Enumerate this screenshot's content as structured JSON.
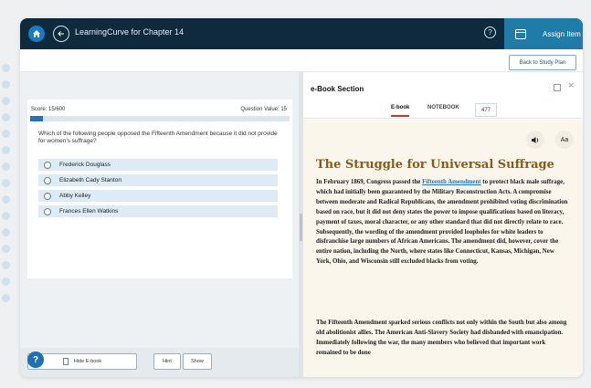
{
  "app": {
    "title": "LearningCurve for Chapter 14",
    "assign_label": "Assign Item",
    "back_to_study_plan": "Back to Study Plan",
    "colors": {
      "topbar": "#0f2a3d",
      "accent": "#1f7ba8",
      "heading": "#8a5a10",
      "link": "#2a6fb8"
    }
  },
  "quiz": {
    "score": "Score: 15/600",
    "question_value": "Question Value: 15",
    "progress_fraction": 0.05,
    "question": "Which of the following people opposed the Fifteenth Amendment because it did not provide for women's suffrage?",
    "options": [
      "Frederick Douglass",
      "Elizabeth Cady Stanton",
      "Abby Kelley",
      "Frances Ellen Watkins"
    ],
    "hide_ebook": "Hide E-book",
    "hint": "Hint",
    "show": "Show"
  },
  "ebook": {
    "section_title": "e-Book Section",
    "tabs": [
      "E-book",
      "NOTEBOOK"
    ],
    "tab_count": "477",
    "aa_label": "Aa",
    "heading": "The Struggle for Universal Suffrage",
    "p1_before": "In February 1869, Congress passed the ",
    "p1_link": "Fifteenth Amendment",
    "p1_after": " to protect black male suffrage, which had initially been guaranteed by the Military Reconstruction Acts. A compromise between moderate and Radical Republicans, the amendment prohibited voting discrimination based on race, but it did not deny states the power to impose qualifications based on literacy, payment of taxes, moral character, or any other standard that did not directly relate to race. Subsequently, the wording of the amendment provided loopholes for white leaders to disfranchise large numbers of African Americans. The amendment did, however, cover the entire nation, including the North, where states like Connecticut, Kansas, Michigan, New York, Ohio, and Wisconsin still excluded blacks from voting.",
    "p2": "The Fifteenth Amendment sparked serious conflicts not only within the South but also among old abolitionist allies. The American Anti-Slavery Society had disbanded with emancipation. Immediately following the war, the many members who believed that important work remained to be done"
  }
}
